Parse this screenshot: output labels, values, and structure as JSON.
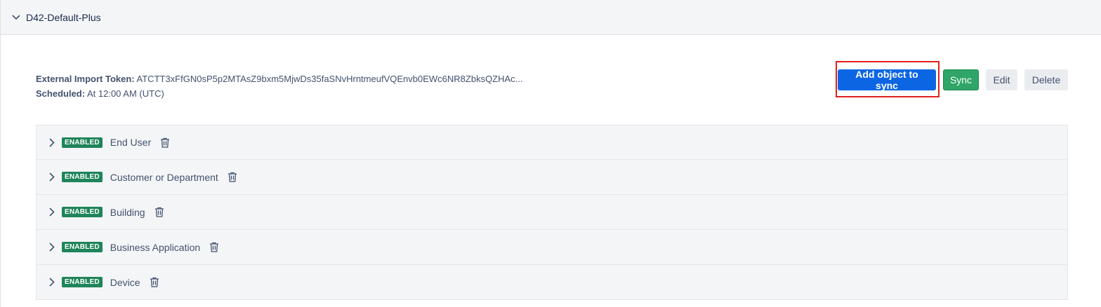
{
  "panel": {
    "title": "D42-Default-Plus"
  },
  "info": {
    "token_label": "External Import Token:",
    "token_value": "ATCTT3xFfGN0sP5p2MTAsZ9bxm5MjwDs35faSNvHrntmeufVQEnvb0EWc6NR8ZbksQZHAc...",
    "scheduled_label": "Scheduled:",
    "scheduled_value": "At 12:00 AM (UTC)"
  },
  "actions": {
    "add_label": "Add object to sync",
    "sync_label": "Sync",
    "edit_label": "Edit",
    "delete_label": "Delete"
  },
  "objects": [
    {
      "status": "ENABLED",
      "label": "End User"
    },
    {
      "status": "ENABLED",
      "label": "Customer or Department"
    },
    {
      "status": "ENABLED",
      "label": "Building"
    },
    {
      "status": "ENABLED",
      "label": "Business Application"
    },
    {
      "status": "ENABLED",
      "label": "Device"
    }
  ],
  "icons": {
    "collapse": "chevron-down-icon",
    "expand": "chevron-right-icon",
    "delete": "trash-icon"
  },
  "colors": {
    "primary": "#0c66e4",
    "sync": "#2fa568",
    "badge": "#1f845a",
    "highlight": "#e0201f"
  }
}
